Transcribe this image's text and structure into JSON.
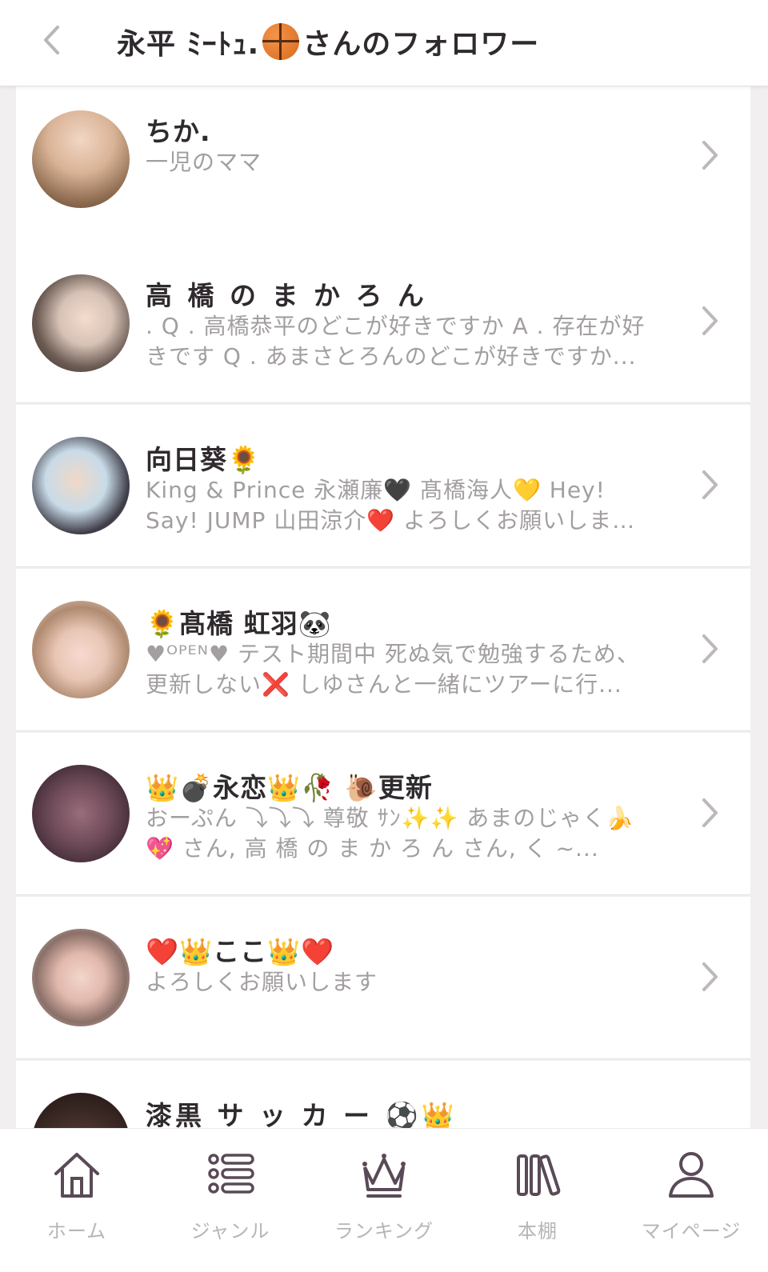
{
  "header": {
    "title_part1": "永平 ﾐｰﾄｭ.",
    "title_part2": "さんのフォロワー"
  },
  "followers": [
    {
      "name": "ちか.",
      "bio": "一児のママ"
    },
    {
      "name": "高 橋 の ま か ろ ん",
      "bio": ". Q . 高橋恭平のどこが好きですか A . 存在が好きです Q . あまさとろんのどこが好きですか..."
    },
    {
      "name": "向日葵🌻",
      "bio": "King & Prince 永瀬廉🖤 髙橋海人💛 Hey! Say! JUMP 山田涼介❤️ よろしくお願いします！"
    },
    {
      "name": "🌻髙橋 虹羽🐼",
      "bio": "♥ᴼᴾᴱᴺ♥ テスト期間中 死ぬ気で勉強するため、更新しない❌ しゆさんと一緒にツアーに行..."
    },
    {
      "name": "👑💣永恋👑🥀 🐌更新",
      "bio": "おーぷん ⤵︎⤵︎⤵︎ 尊敬 ｻﾝ✨✨ あまのじゃく🍌💖 さん, 高 橋 の ま か ろ ん さん, く ~..."
    },
    {
      "name": "❤️👑ここ👑❤️",
      "bio": "よろしくお願いします"
    },
    {
      "name": "漆黒 サ ッ カ ー ⚽👑",
      "bio": ""
    }
  ],
  "tabs": [
    {
      "label": "ホーム",
      "icon": "home-icon"
    },
    {
      "label": "ジャンル",
      "icon": "list-icon"
    },
    {
      "label": "ランキング",
      "icon": "crown-icon"
    },
    {
      "label": "本棚",
      "icon": "bookshelf-icon"
    },
    {
      "label": "マイページ",
      "icon": "person-icon"
    }
  ],
  "colors": {
    "text_primary": "#2f2a2e",
    "text_secondary": "#a29ea1",
    "icon": "#5a4a57",
    "tab_label": "#b8b4b7",
    "list_background": "#f2eff1"
  }
}
